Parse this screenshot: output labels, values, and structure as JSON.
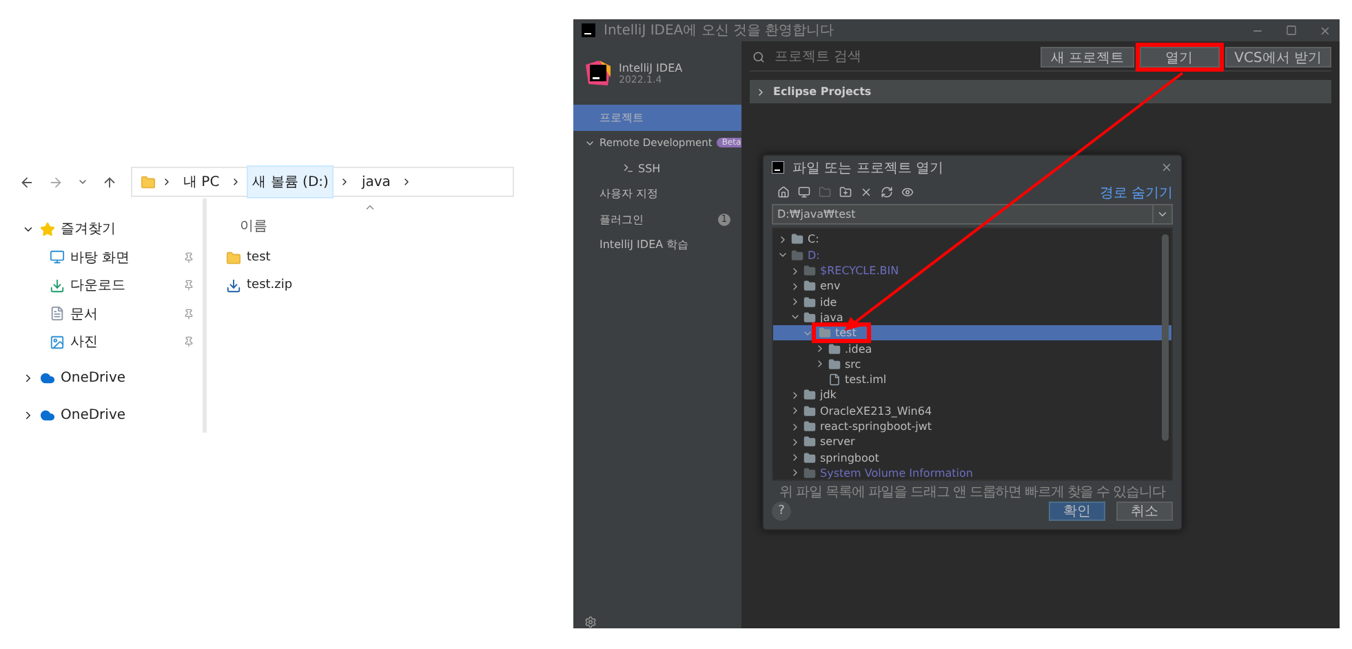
{
  "explorer": {
    "breadcrumb": [
      {
        "label": "내 PC",
        "selected": false
      },
      {
        "label": "새 볼륨 (D:)",
        "selected": true
      },
      {
        "label": "java",
        "selected": false
      }
    ],
    "sidebar": [
      {
        "label": "즐겨찾기",
        "kind": "star",
        "expanded": true,
        "children": [
          {
            "label": "바탕 화면",
            "kind": "desktop",
            "pinned": true
          },
          {
            "label": "다운로드",
            "kind": "download",
            "pinned": true
          },
          {
            "label": "문서",
            "kind": "document",
            "pinned": true
          },
          {
            "label": "사진",
            "kind": "photo",
            "pinned": true
          }
        ]
      },
      {
        "label": "OneDrive",
        "kind": "cloud",
        "expanded": false
      },
      {
        "label": "OneDrive",
        "kind": "cloud",
        "expanded": false
      }
    ],
    "column": "이름",
    "files": [
      {
        "name": "test",
        "kind": "folder"
      },
      {
        "name": "test.zip",
        "kind": "zip"
      }
    ]
  },
  "ide": {
    "title": "IntelliJ IDEA에 오신 것을 환영합니다",
    "product": "IntelliJ IDEA",
    "version": "2022.1.4",
    "nav": [
      {
        "label": "프로젝트",
        "selected": true
      },
      {
        "label": "Remote Development",
        "badge": "Beta",
        "expanded": true,
        "selected": false,
        "children": [
          {
            "label": "SSH",
            "selected": false
          }
        ]
      },
      {
        "label": "사용자 지정",
        "selected": false
      },
      {
        "label": "플러그인",
        "count": "1",
        "selected": false
      },
      {
        "label": "IntelliJ IDEA 학습",
        "selected": false
      }
    ],
    "search": {
      "placeholder": "프로젝트 검색"
    },
    "buttons": [
      {
        "label": "새 프로젝트",
        "highlighted": false
      },
      {
        "label": "열기",
        "highlighted": true
      },
      {
        "label": "VCS에서 받기",
        "highlighted": false
      }
    ],
    "groups": [
      {
        "label": "Eclipse Projects",
        "expanded": false
      }
    ],
    "dialog": {
      "title": "파일 또는 프로젝트 열기",
      "hide_path": "경로 숨기기",
      "path": "D:₩java₩test",
      "tree": [
        {
          "label": "C:",
          "kind": "folder",
          "expanded": false,
          "hidden": false
        },
        {
          "label": "D:",
          "kind": "folder",
          "expanded": true,
          "hidden": true,
          "children": [
            {
              "label": "$RECYCLE.BIN",
              "kind": "folder",
              "expanded": false,
              "hidden": true
            },
            {
              "label": "env",
              "kind": "folder",
              "expanded": false,
              "hidden": false
            },
            {
              "label": "ide",
              "kind": "folder",
              "expanded": false,
              "hidden": false
            },
            {
              "label": "java",
              "kind": "folder",
              "expanded": true,
              "hidden": false,
              "children": [
                {
                  "label": "test",
                  "kind": "project",
                  "expanded": true,
                  "hidden": false,
                  "selected": true,
                  "highlighted": true,
                  "children": [
                    {
                      "label": ".idea",
                      "kind": "folder",
                      "expanded": false,
                      "hidden": false
                    },
                    {
                      "label": "src",
                      "kind": "folder",
                      "expanded": false,
                      "hidden": false
                    },
                    {
                      "label": "test.iml",
                      "kind": "file",
                      "hidden": false
                    }
                  ]
                }
              ]
            },
            {
              "label": "jdk",
              "kind": "folder",
              "expanded": false,
              "hidden": false
            },
            {
              "label": "OracleXE213_Win64",
              "kind": "folder",
              "expanded": false,
              "hidden": false
            },
            {
              "label": "react-springboot-jwt",
              "kind": "folder",
              "expanded": false,
              "hidden": false
            },
            {
              "label": "server",
              "kind": "folder",
              "expanded": false,
              "hidden": false
            },
            {
              "label": "springboot",
              "kind": "folder",
              "expanded": false,
              "hidden": false
            },
            {
              "label": "System Volume Information",
              "kind": "folder",
              "expanded": false,
              "hidden": true
            }
          ]
        }
      ],
      "hint": "위 파일 목록에 파일을 드래그 앤 드롭하면 빠르게 찾을 수 있습니다",
      "help": "?",
      "buttons": [
        {
          "label": "확인",
          "default": true
        },
        {
          "label": "취소",
          "default": false
        }
      ]
    }
  }
}
